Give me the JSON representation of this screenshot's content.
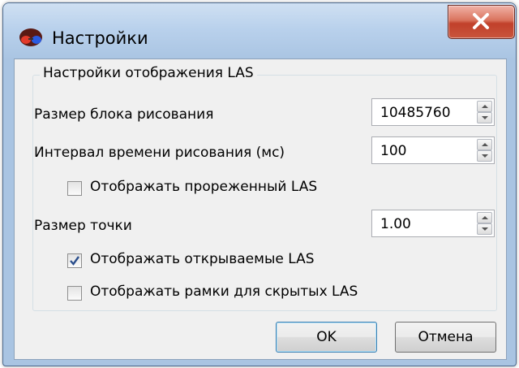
{
  "window": {
    "title": "Настройки",
    "icon": "glasses-app-icon"
  },
  "group": {
    "title": "Настройки отображения LAS",
    "fields": [
      {
        "label": "Размер блока рисования",
        "value": "10485760"
      },
      {
        "label": "Интервал времени рисования (мс)",
        "value": "100"
      },
      {
        "label": "Размер точки",
        "value": "1.00"
      }
    ],
    "checkboxes": [
      {
        "label": "Отображать прореженный LAS",
        "checked": false
      },
      {
        "label": "Отображать открываемые LAS",
        "checked": true
      },
      {
        "label": "Отображать рамки для скрытых LAS",
        "checked": false
      }
    ]
  },
  "buttons": {
    "ok": "OK",
    "cancel": "Отмена"
  },
  "colors": {
    "frame": "#a9c4e2",
    "close_button": "#c9553c",
    "default_button_border": "#3c7fb1"
  }
}
